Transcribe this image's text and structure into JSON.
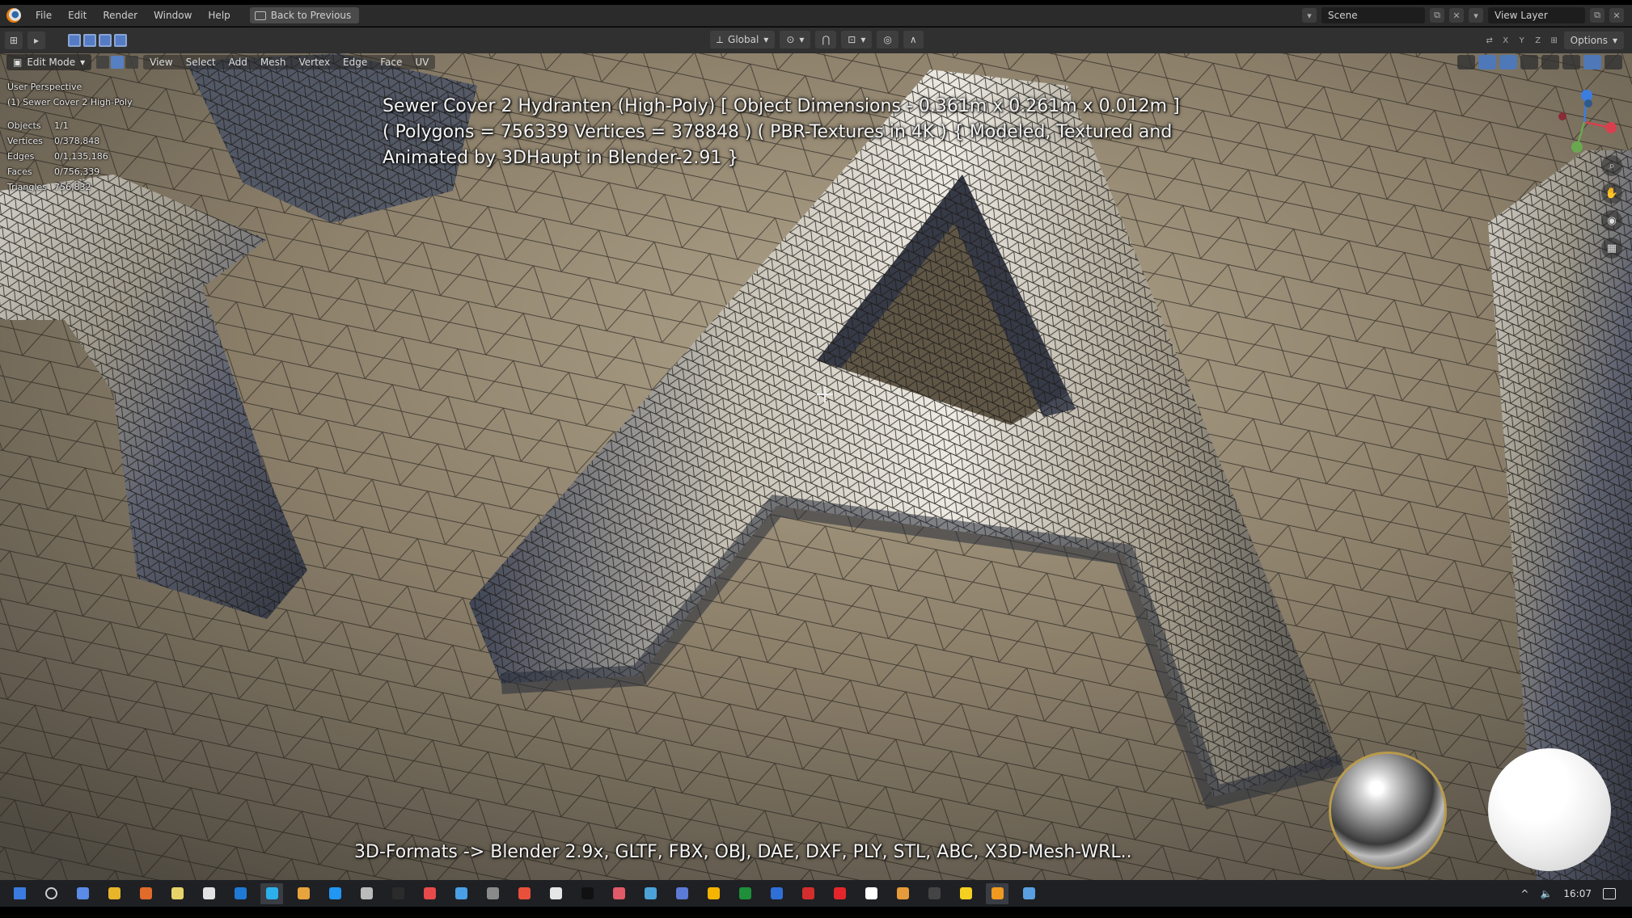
{
  "app": {
    "menu": [
      "File",
      "Edit",
      "Render",
      "Window",
      "Help"
    ],
    "back_button": "Back to Previous",
    "scene": "Scene",
    "view_layer": "View Layer"
  },
  "header": {
    "transform_orientation": "Global",
    "options": "Options",
    "axes": [
      "X",
      "Y",
      "Z"
    ]
  },
  "viewport": {
    "mode": "Edit Mode",
    "menu": [
      "View",
      "Select",
      "Add",
      "Mesh",
      "Vertex",
      "Edge",
      "Face",
      "UV"
    ],
    "perspective": "User Perspective",
    "object_name": "(1) Sewer Cover 2 High-Poly",
    "stats": [
      {
        "key": "Objects",
        "value": "1/1"
      },
      {
        "key": "Vertices",
        "value": "0/378,848"
      },
      {
        "key": "Edges",
        "value": "0/1,135,186"
      },
      {
        "key": "Faces",
        "value": "0/756,339"
      },
      {
        "key": "Triangles",
        "value": "756,832"
      }
    ]
  },
  "overlay": {
    "title_line1": "Sewer Cover 2 Hydranten (High-Poly) [ Object Dimensions -  0.361m x 0.261m x 0.012m ]",
    "title_line2": "( Polygons = 756339 Vertices = 378848 ) ( PBR-Textures in 4K ) { Modeled, Textured and",
    "title_line3": "Animated by 3DHaupt in Blender-2.91 }",
    "formats": "3D-Formats -> Blender 2.9x, GLTF, FBX, OBJ, DAE, DXF, PLY, STL, ABC, X3D-Mesh-WRL.."
  },
  "taskbar": {
    "time": "16:07",
    "icon_colors": [
      "#3b7be0",
      "#cfcfcf",
      "#5a8be8",
      "#e8b52a",
      "#e06b2a",
      "#e8d36a",
      "#e2e2e2",
      "#1f7ad6",
      "#2bb0ec",
      "#e8a43c",
      "#2196f3",
      "#bbbbbb",
      "#2b2b2b",
      "#e64a4a",
      "#4aa0e6",
      "#8a8a8a",
      "#e8503c",
      "#e6e6e6",
      "#111111",
      "#e05a6a",
      "#4ca3d8",
      "#5b7bd6",
      "#f4b400",
      "#1f8f3a",
      "#2f6fd8",
      "#d42d2d",
      "#e4262c",
      "#ffffff",
      "#e89b3a",
      "#444444",
      "#f5d020",
      "#f19a1f",
      "#5aa0e0"
    ]
  }
}
